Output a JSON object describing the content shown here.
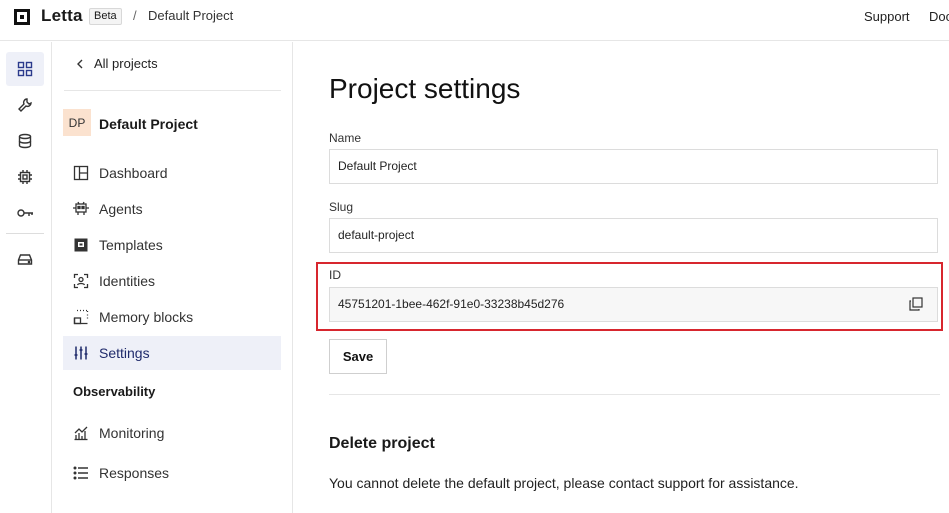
{
  "header": {
    "brand": "Letta",
    "badge": "Beta",
    "separator": "/",
    "breadcrumb": "Default Project",
    "links": [
      "Support",
      "Doc"
    ]
  },
  "rail": {
    "icons": [
      "grid-icon",
      "wrench-icon",
      "database-icon",
      "chip-icon",
      "key-icon",
      "drive-icon"
    ]
  },
  "sidebar": {
    "back_label": "All projects",
    "project_initials": "DP",
    "project_name": "Default Project",
    "items": [
      {
        "label": "Dashboard",
        "icon": "dashboard-icon"
      },
      {
        "label": "Agents",
        "icon": "agents-icon"
      },
      {
        "label": "Templates",
        "icon": "templates-icon"
      },
      {
        "label": "Identities",
        "icon": "identities-icon"
      },
      {
        "label": "Memory blocks",
        "icon": "memory-blocks-icon"
      },
      {
        "label": "Settings",
        "icon": "settings-icon",
        "active": true
      }
    ],
    "section_title": "Observability",
    "observability_items": [
      {
        "label": "Monitoring",
        "icon": "monitoring-icon"
      },
      {
        "label": "Responses",
        "icon": "responses-icon"
      }
    ]
  },
  "main": {
    "title": "Project settings",
    "name_label": "Name",
    "name_value": "Default Project",
    "slug_label": "Slug",
    "slug_value": "default-project",
    "id_label": "ID",
    "id_value": "45751201-1bee-462f-91e0-33238b45d276",
    "save_label": "Save",
    "delete_title": "Delete project",
    "delete_text": "You cannot delete the default project, please contact support for assistance."
  },
  "colors": {
    "highlight": "#d7262e",
    "active_bg": "#eef0f8",
    "badge_bg": "#fbe2cf"
  }
}
